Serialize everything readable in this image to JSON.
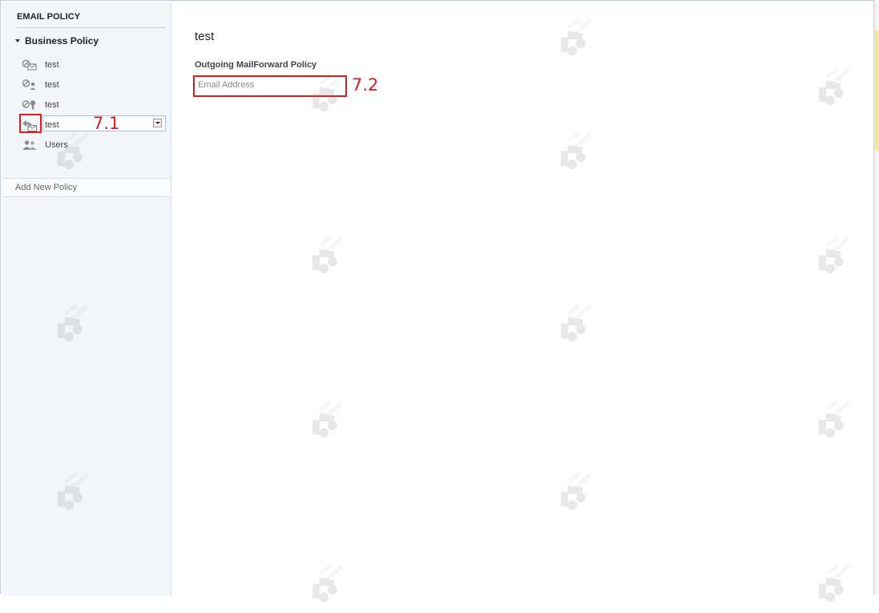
{
  "sidebar": {
    "header": "EMAIL POLICY",
    "group": {
      "label": "Business Policy",
      "expanded": true
    },
    "items": [
      {
        "icon": "mail-block-icon",
        "label": "test"
      },
      {
        "icon": "mail-user-icon",
        "label": "test"
      },
      {
        "icon": "mail-key-icon",
        "label": "test"
      },
      {
        "icon": "mail-forward-icon",
        "label": "test",
        "selected": true
      },
      {
        "icon": "users-icon",
        "label": "Users"
      }
    ],
    "add_policy": "Add New Policy"
  },
  "main": {
    "title": "test",
    "section_label": "Outgoing MailForward Policy",
    "email_placeholder": "Email Address",
    "email_value": ""
  },
  "annotations": [
    {
      "label": "7.1"
    },
    {
      "label": "7.2"
    }
  ],
  "watermark": {
    "text_line1": "mail",
    "text_line2": "master"
  },
  "colors": {
    "annotation": "#d71e1e",
    "selection_border": "#9fc1e4",
    "sidebar_bg": "#f3f6f9"
  }
}
